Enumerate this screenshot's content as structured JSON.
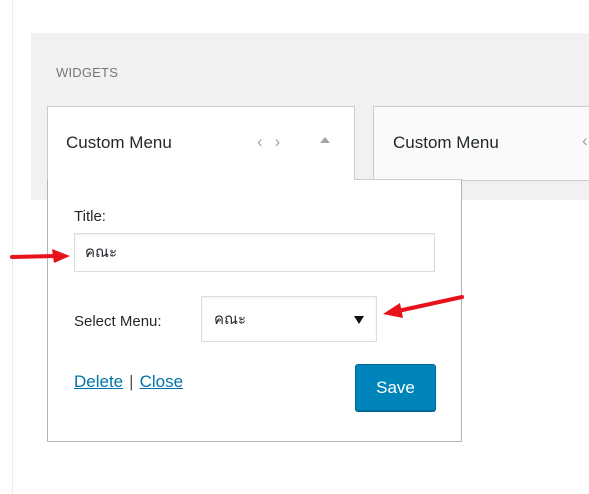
{
  "section": {
    "title": "WIDGETS"
  },
  "widgets": [
    {
      "title": "Custom Menu",
      "nav_left": "‹",
      "nav_right": "›"
    },
    {
      "title": "Custom Menu",
      "nav_left": "‹"
    }
  ],
  "form": {
    "title_label": "Title:",
    "title_value": "คณะ",
    "select_label": "Select Menu:",
    "select_value": "คณะ",
    "delete_label": "Delete",
    "separator": "|",
    "close_label": "Close",
    "save_label": "Save"
  },
  "colors": {
    "accent": "#0085ba",
    "link": "#0073aa",
    "annotation_arrow": "#e8121b"
  },
  "icons": [
    "chevron-left-icon",
    "chevron-right-icon",
    "collapse-up-icon",
    "red-arrow-icon"
  ]
}
